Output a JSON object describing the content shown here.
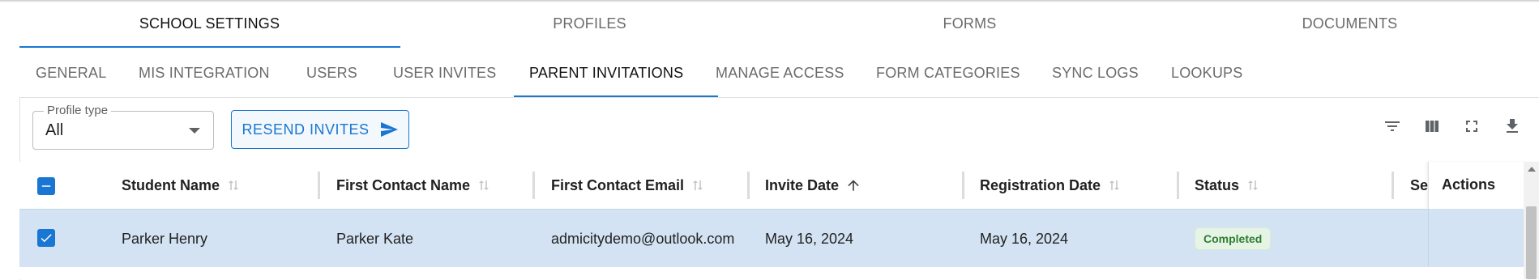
{
  "main_tabs": [
    {
      "label": "SCHOOL SETTINGS",
      "active": true
    },
    {
      "label": "PROFILES",
      "active": false
    },
    {
      "label": "FORMS",
      "active": false
    },
    {
      "label": "DOCUMENTS",
      "active": false
    }
  ],
  "sub_tabs": [
    {
      "label": "GENERAL",
      "active": false
    },
    {
      "label": "MIS INTEGRATION",
      "active": false
    },
    {
      "label": "USERS",
      "active": false
    },
    {
      "label": "USER INVITES",
      "active": false
    },
    {
      "label": "PARENT INVITATIONS",
      "active": true
    },
    {
      "label": "MANAGE ACCESS",
      "active": false
    },
    {
      "label": "FORM CATEGORIES",
      "active": false
    },
    {
      "label": "SYNC LOGS",
      "active": false
    },
    {
      "label": "LOOKUPS",
      "active": false
    }
  ],
  "toolbar": {
    "profile_type_label": "Profile type",
    "profile_type_value": "All",
    "resend_label": "RESEND INVITES",
    "icons": [
      "filter-icon",
      "columns-icon",
      "fullscreen-icon",
      "download-icon"
    ]
  },
  "table": {
    "columns": [
      {
        "label": "Student Name",
        "sort": "none"
      },
      {
        "label": "First Contact Name",
        "sort": "none"
      },
      {
        "label": "First Contact Email",
        "sort": "none"
      },
      {
        "label": "Invite Date",
        "sort": "asc"
      },
      {
        "label": "Registration Date",
        "sort": "none"
      },
      {
        "label": "Status",
        "sort": "none"
      },
      {
        "label": "Secor",
        "sort": "none"
      }
    ],
    "actions_label": "Actions",
    "header_checkbox": "indeterminate",
    "rows": [
      {
        "selected": true,
        "student_name": "Parker Henry",
        "first_contact_name": "Parker Kate",
        "first_contact_email": "admicitydemo@outlook.com",
        "invite_date": "May 16, 2024",
        "registration_date": "May 16, 2024",
        "status": "Completed"
      }
    ]
  },
  "colors": {
    "accent": "#1976d2",
    "selected_row": "#d3e3f4",
    "status_completed_bg": "#e6f4e6",
    "status_completed_text": "#2e7d32"
  }
}
